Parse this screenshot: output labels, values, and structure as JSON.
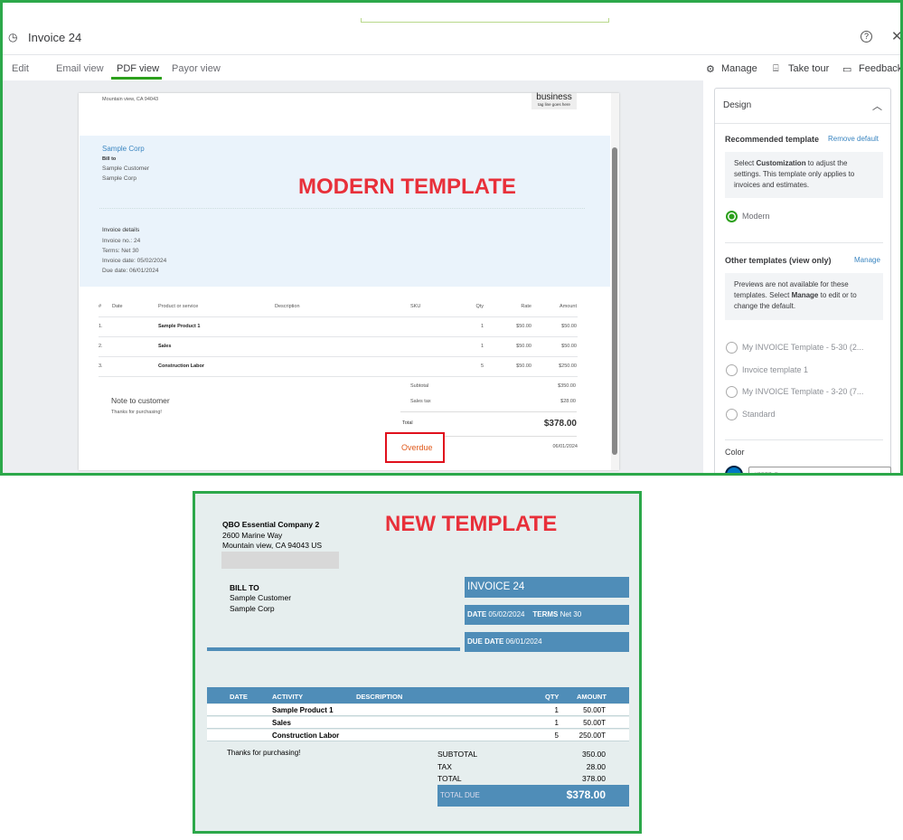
{
  "app": {
    "title": "Invoice 24",
    "tabs": [
      "Edit",
      "Email view",
      "PDF view",
      "Payor view"
    ],
    "active_tab": "PDF view",
    "actions": {
      "manage": "Manage",
      "take_tour": "Take tour",
      "feedback": "Feedback"
    },
    "accent": "#2ca01c"
  },
  "modern": {
    "address": "Mountain view, CA 94043",
    "logo_text": "business",
    "logo_tagline": "tag line goes here",
    "customer_name": "Sample Corp",
    "bill_to_label": "Bill to",
    "bill_to": [
      "Sample Customer",
      "Sample Corp"
    ],
    "annotation": "MODERN TEMPLATE",
    "details_label": "Invoice details",
    "details": [
      "Invoice no.: 24",
      "Terms: Net 30",
      "Invoice date: 05/02/2024",
      "Due date: 06/01/2024"
    ],
    "columns": [
      "#",
      "Date",
      "Product or service",
      "Description",
      "SKU",
      "Qty",
      "Rate",
      "Amount"
    ],
    "rows": [
      [
        "1.",
        "",
        "Sample Product 1",
        "",
        "",
        "1",
        "$50.00",
        "$50.00"
      ],
      [
        "2.",
        "",
        "Sales",
        "",
        "",
        "1",
        "$50.00",
        "$50.00"
      ],
      [
        "3.",
        "",
        "Construction Labor",
        "",
        "",
        "5",
        "$50.00",
        "$250.00"
      ]
    ],
    "subtotal_label": "Subtotal",
    "subtotal": "$350.00",
    "tax_label": "Sales tax",
    "tax": "$28.00",
    "total_label": "Total",
    "total": "$378.00",
    "note_label": "Note to customer",
    "note": "Thanks for purchasing!",
    "status": "Overdue",
    "due": "06/01/2024"
  },
  "design": {
    "header": "Design",
    "recommended": "Recommended template",
    "remove_default": "Remove default",
    "info1_a": "Select ",
    "info1_b": "Customization",
    "info1_c": " to adjust the settings. This template only applies to invoices and estimates.",
    "selected": "Modern",
    "other": "Other templates (view only)",
    "manage": "Manage",
    "info2_a": "Previews are not available for these templates. Select ",
    "info2_b": "Manage",
    "info2_c": " to edit or to change the default.",
    "templates": [
      "My INVOICE Template - 5-30 (2...",
      "Invoice template 1",
      "My INVOICE Template - 3-20 (7...",
      "Standard"
    ],
    "color_label": "Color",
    "color_value": "#0077c5"
  },
  "newt": {
    "company": "QBO Essential Company 2",
    "address": [
      "2600 Marine Way",
      "Mountain view, CA  94043 US"
    ],
    "annotation": "NEW TEMPLATE",
    "bill_to_label": "BILL TO",
    "bill_to": [
      "Sample Customer",
      "Sample Corp"
    ],
    "title": "INVOICE 24",
    "date_label": "DATE",
    "date": "05/02/2024",
    "terms_label": "TERMS",
    "terms": "Net 30",
    "due_label": "DUE DATE",
    "due": "06/01/2024",
    "columns": [
      "DATE",
      "ACTIVITY",
      "DESCRIPTION",
      "QTY",
      "AMOUNT"
    ],
    "rows": [
      [
        "",
        "Sample Product 1",
        "",
        "1",
        "50.00T"
      ],
      [
        "",
        "Sales",
        "",
        "1",
        "50.00T"
      ],
      [
        "",
        "Construction Labor",
        "",
        "5",
        "250.00T"
      ]
    ],
    "note": "Thanks for purchasing!",
    "subtotal_label": "SUBTOTAL",
    "subtotal": "350.00",
    "tax_label": "TAX",
    "tax": "28.00",
    "total_label": "TOTAL",
    "total": "378.00",
    "total_due_label": "TOTAL DUE",
    "total_due": "$378.00",
    "color": "#4f8db8"
  }
}
